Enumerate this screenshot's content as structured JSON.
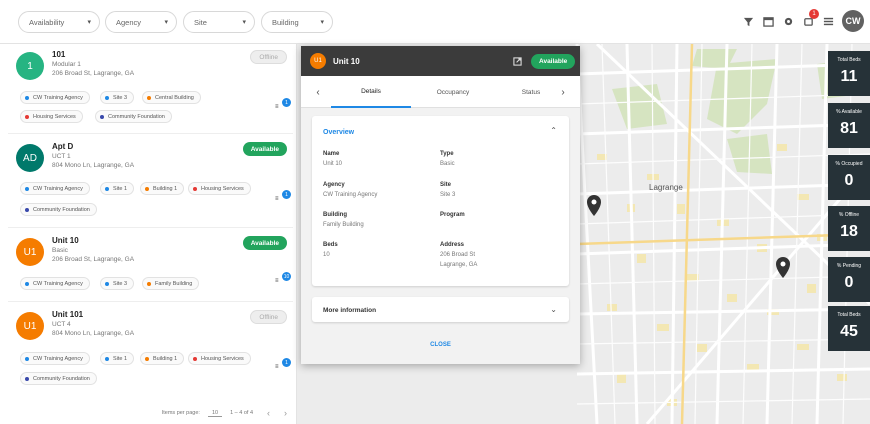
{
  "filters": [
    {
      "label": "Availability"
    },
    {
      "label": "Agency"
    },
    {
      "label": "Site"
    },
    {
      "label": "Building"
    }
  ],
  "topbar": {
    "notifications": "1",
    "user_initials": "CW"
  },
  "units": [
    {
      "initials": "1",
      "color": "#26b482",
      "title": "101",
      "line1": "Modular 1",
      "line2": "206 Broad St, Lagrange, GA",
      "status": "Offline",
      "status_type": "offline",
      "messages": "1",
      "tags": [
        {
          "label": "CW Training Agency",
          "color": "#1e88e5"
        },
        {
          "label": "Site 3",
          "color": "#1e88e5"
        },
        {
          "label": "Central Building",
          "color": "#f57c00"
        },
        {
          "label": "Housing Services",
          "color": "#e53935"
        },
        {
          "label": "Community Foundation",
          "color": "#3949ab"
        }
      ]
    },
    {
      "initials": "AD",
      "color": "#00796b",
      "title": "Apt D",
      "line1": "UCT 1",
      "line2": "804 Mono Ln, Lagrange, GA",
      "status": "Available",
      "status_type": "available",
      "messages": "1",
      "tags": [
        {
          "label": "CW Training Agency",
          "color": "#1e88e5"
        },
        {
          "label": "Site 1",
          "color": "#1e88e5"
        },
        {
          "label": "Building 1",
          "color": "#f57c00"
        },
        {
          "label": "Housing Services",
          "color": "#e53935"
        },
        {
          "label": "Community Foundation",
          "color": "#3949ab"
        }
      ]
    },
    {
      "initials": "U1",
      "color": "#f57c00",
      "title": "Unit 10",
      "line1": "Basic",
      "line2": "206 Broad St, Lagrange, GA",
      "status": "Available",
      "status_type": "available",
      "messages": "10",
      "tags": [
        {
          "label": "CW Training Agency",
          "color": "#1e88e5"
        },
        {
          "label": "Site 3",
          "color": "#1e88e5"
        },
        {
          "label": "Family Building",
          "color": "#f57c00"
        }
      ]
    },
    {
      "initials": "U1",
      "color": "#f57c00",
      "title": "Unit 101",
      "line1": "UCT 4",
      "line2": "804 Mono Ln, Lagrange, GA",
      "status": "Offline",
      "status_type": "offline",
      "messages": "1",
      "tags": [
        {
          "label": "CW Training Agency",
          "color": "#1e88e5"
        },
        {
          "label": "Site 1",
          "color": "#1e88e5"
        },
        {
          "label": "Building 1",
          "color": "#f57c00"
        },
        {
          "label": "Housing Services",
          "color": "#e53935"
        },
        {
          "label": "Community Foundation",
          "color": "#3949ab"
        }
      ]
    }
  ],
  "pager": {
    "items_label": "Items per page:",
    "per_page": "10",
    "range": "1 – 4 of 4"
  },
  "map": {
    "city_label": "Lagrange"
  },
  "stats": [
    {
      "label": "Total Beds",
      "value": "11"
    },
    {
      "label": "% Available",
      "value": "81"
    },
    {
      "label": "% Occupied",
      "value": "0"
    },
    {
      "label": "% Offline",
      "value": "18"
    },
    {
      "label": "% Pending",
      "value": "0"
    },
    {
      "label": "Total Beds",
      "value": "45"
    }
  ],
  "panel": {
    "avatar": "U1",
    "title": "Unit 10",
    "status": "Available",
    "tabs": [
      "Details",
      "Occupancy",
      "Status"
    ],
    "overview_title": "Overview",
    "fields": [
      {
        "label": "Name",
        "value": "Unit 10"
      },
      {
        "label": "Type",
        "value": "Basic"
      },
      {
        "label": "Agency",
        "value": "CW Training Agency"
      },
      {
        "label": "Site",
        "value": "Site 3"
      },
      {
        "label": "Building",
        "value": "Family Building"
      },
      {
        "label": "Program",
        "value": ""
      },
      {
        "label": "Beds",
        "value": "10"
      },
      {
        "label": "Address",
        "value": "206 Broad St",
        "value2": "Lagrange, GA"
      }
    ],
    "more_title": "More information",
    "close_label": "CLOSE"
  }
}
